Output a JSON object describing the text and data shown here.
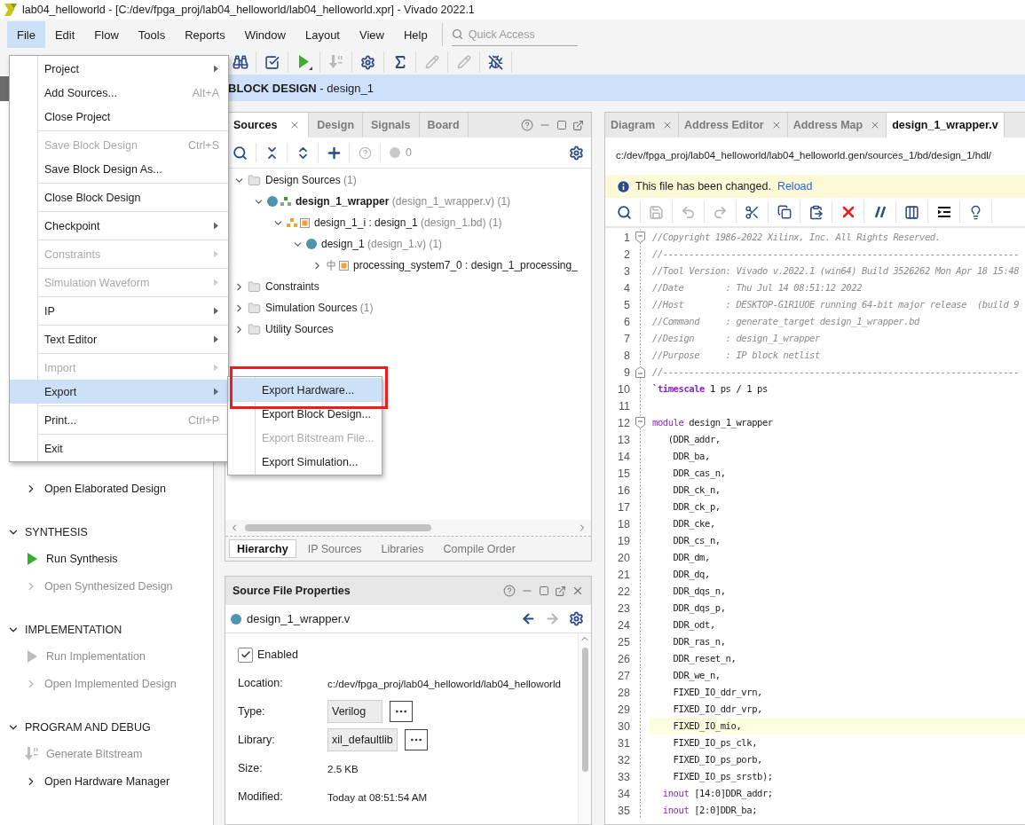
{
  "window": {
    "title": "lab04_helloworld - [C:/dev/fpga_proj/lab04_helloworld/lab04_helloworld.xpr] - Vivado 2022.1"
  },
  "menu_bar": [
    {
      "label": "File",
      "selected": true
    },
    {
      "label": "Edit",
      "selected": false
    },
    {
      "label": "Flow",
      "selected": false
    },
    {
      "label": "Tools",
      "selected": false
    },
    {
      "label": "Reports",
      "selected": false
    },
    {
      "label": "Window",
      "selected": false
    },
    {
      "label": "Layout",
      "selected": false
    },
    {
      "label": "View",
      "selected": false
    },
    {
      "label": "Help",
      "selected": false
    }
  ],
  "quick_access": {
    "placeholder": "Quick Access"
  },
  "toolbar": [
    {
      "kind": "binoculars",
      "disabled": false
    },
    {
      "kind": "check",
      "disabled": false
    },
    {
      "kind": "run",
      "disabled": false
    },
    {
      "kind": "bitstream",
      "disabled": true
    },
    {
      "kind": "gear",
      "disabled": false
    },
    {
      "kind": "sigma",
      "disabled": false
    },
    {
      "kind": "probe",
      "disabled": true
    },
    {
      "kind": "probe",
      "disabled": true
    },
    {
      "kind": "debug",
      "disabled": false
    }
  ],
  "flow_navigator": {
    "sections": [
      {
        "items": [
          {
            "label": "Open Elaborated Design",
            "kind": "expand",
            "disabled": false
          }
        ]
      },
      {
        "title": "SYNTHESIS",
        "expanded": true,
        "items": [
          {
            "label": "Run Synthesis",
            "kind": "run",
            "disabled": false
          },
          {
            "label": "Open Synthesized Design",
            "kind": "expand",
            "disabled": true
          }
        ]
      },
      {
        "title": "IMPLEMENTATION",
        "expanded": true,
        "items": [
          {
            "label": "Run Implementation",
            "kind": "run",
            "disabled": true
          },
          {
            "label": "Open Implemented Design",
            "kind": "expand",
            "disabled": true
          }
        ]
      },
      {
        "title": "PROGRAM AND DEBUG",
        "expanded": true,
        "items": [
          {
            "label": "Generate Bitstream",
            "kind": "bitstream",
            "disabled": true
          },
          {
            "label": "Open Hardware Manager",
            "kind": "expand",
            "disabled": false
          }
        ]
      }
    ]
  },
  "header": {
    "title": "**BLOCK DESIGN** - design_1"
  },
  "sources_panel": {
    "tabs": [
      {
        "label": "Sources",
        "selected": true
      },
      {
        "label": "Design",
        "selected": false
      },
      {
        "label": "Signals",
        "selected": false
      },
      {
        "label": "Board",
        "selected": false
      }
    ],
    "issue_count": "0",
    "tree": [
      {
        "name": "Design Sources",
        "detail": "(1)",
        "kind": "folder",
        "expanded": true,
        "children": [
          {
            "name": "design_1_wrapper",
            "detail": "(design_1_wrapper.v) (1)",
            "kind": "top-module",
            "expanded": true,
            "children": [
              {
                "name": "design_1_i : design_1",
                "detail": "(design_1.bd) (1)",
                "kind": "block-design",
                "expanded": true,
                "children": [
                  {
                    "name": "design_1",
                    "detail": "(design_1.v) (1)",
                    "kind": "module",
                    "expanded": true,
                    "children": [
                      {
                        "name": "processing_system7_0 : design_1_processing_",
                        "kind": "ip",
                        "expanded": false
                      }
                    ]
                  }
                ]
              }
            ]
          }
        ]
      },
      {
        "name": "Constraints",
        "kind": "folder",
        "expanded": false
      },
      {
        "name": "Simulation Sources",
        "detail": "(1)",
        "kind": "folder",
        "expanded": false
      },
      {
        "name": "Utility Sources",
        "kind": "folder",
        "expanded": false
      }
    ],
    "bottom_tabs": [
      {
        "label": "Hierarchy",
        "selected": true
      },
      {
        "label": "IP Sources",
        "selected": false
      },
      {
        "label": "Libraries",
        "selected": false
      },
      {
        "label": "Compile Order",
        "selected": false
      }
    ]
  },
  "properties_panel": {
    "title": "Source File Properties",
    "file": "design_1_wrapper.v",
    "enabled": {
      "label": "Enabled",
      "checked": true
    },
    "rows": [
      {
        "label": "Location:",
        "value": "c:/dev/fpga_proj/lab04_helloworld/lab04_helloworld",
        "kind": "text"
      },
      {
        "label": "Type:",
        "value": "Verilog",
        "kind": "select"
      },
      {
        "label": "Library:",
        "value": "xil_defaultlib",
        "kind": "select"
      },
      {
        "label": "Size:",
        "value": "2.5 KB",
        "kind": "text"
      },
      {
        "label": "Modified:",
        "value": "Today at 08:51:54 AM",
        "kind": "text"
      }
    ]
  },
  "editor": {
    "tabs": [
      {
        "label": "Diagram",
        "selected": false
      },
      {
        "label": "Address Editor",
        "selected": false
      },
      {
        "label": "Address Map",
        "selected": false
      },
      {
        "label": "design_1_wrapper.v",
        "selected": true
      }
    ],
    "path": "c:/dev/fpga_proj/lab04_helloworld/lab04_helloworld.gen/sources_1/bd/design_1/hdl/",
    "notice": {
      "text": "This file has been changed.",
      "link": "Reload"
    },
    "toolbar": [
      {
        "kind": "search",
        "disabled": false
      },
      {
        "kind": "save",
        "disabled": true
      },
      {
        "kind": "undo",
        "disabled": true
      },
      {
        "kind": "redo",
        "disabled": true
      },
      {
        "kind": "cut",
        "disabled": false
      },
      {
        "kind": "copy",
        "disabled": false
      },
      {
        "kind": "paste",
        "disabled": false
      },
      {
        "kind": "delete",
        "disabled": false
      },
      {
        "kind": "comment",
        "disabled": false
      },
      {
        "kind": "columns",
        "disabled": false
      },
      {
        "kind": "indent",
        "disabled": false
      },
      {
        "kind": "hint",
        "disabled": false
      }
    ],
    "lines": [
      {
        "number": "1",
        "kind": "fold-start",
        "current": false,
        "tokens": [
          {
            "text": "//Copyright 1986-2022 Xilinx, Inc. All Rights Reserved.",
            "kind": "comment"
          }
        ]
      },
      {
        "number": "2",
        "current": false,
        "tokens": [
          {
            "text": "//--------------------------------------------------------------------",
            "kind": "comment"
          }
        ]
      },
      {
        "number": "3",
        "current": false,
        "tokens": [
          {
            "text": "//Tool Version: Vivado v.2022.1 (win64) Build 3526262 Mon Apr 18 15:48",
            "kind": "comment"
          }
        ]
      },
      {
        "number": "4",
        "current": false,
        "tokens": [
          {
            "text": "//Date        : Thu Jul 14 08:51:12 2022",
            "kind": "comment"
          }
        ]
      },
      {
        "number": "5",
        "current": false,
        "tokens": [
          {
            "text": "//Host        : DESKTOP-G1R1UOE running 64-bit major release  (build 9",
            "kind": "comment"
          }
        ]
      },
      {
        "number": "6",
        "current": false,
        "tokens": [
          {
            "text": "//Command     : generate_target design_1_wrapper.bd",
            "kind": "comment"
          }
        ]
      },
      {
        "number": "7",
        "current": false,
        "tokens": [
          {
            "text": "//Design      : design_1_wrapper",
            "kind": "comment"
          }
        ]
      },
      {
        "number": "8",
        "current": false,
        "tokens": [
          {
            "text": "//Purpose     : IP block netlist",
            "kind": "comment"
          }
        ]
      },
      {
        "number": "9",
        "kind": "fold-end",
        "current": false,
        "tokens": [
          {
            "text": "//--------------------------------------------------------------------",
            "kind": "comment"
          }
        ]
      },
      {
        "number": "10",
        "current": false,
        "tokens": [
          {
            "text": "`timescale",
            "kind": "directive"
          },
          {
            "text": " 1 ps / 1 ps",
            "kind": "plain"
          }
        ]
      },
      {
        "number": "11",
        "current": false
      },
      {
        "number": "12",
        "kind": "fold-start",
        "current": false,
        "tokens": [
          {
            "text": "module",
            "kind": "keyword"
          },
          {
            "text": " design_1_wrapper",
            "kind": "plain"
          }
        ]
      },
      {
        "number": "13",
        "current": false,
        "tokens": [
          {
            "text": "   (DDR_addr,",
            "kind": "plain"
          }
        ]
      },
      {
        "number": "14",
        "current": false,
        "tokens": [
          {
            "text": "    DDR_ba,",
            "kind": "plain"
          }
        ]
      },
      {
        "number": "15",
        "current": false,
        "tokens": [
          {
            "text": "    DDR_cas_n,",
            "kind": "plain"
          }
        ]
      },
      {
        "number": "16",
        "current": false,
        "tokens": [
          {
            "text": "    DDR_ck_n,",
            "kind": "plain"
          }
        ]
      },
      {
        "number": "17",
        "current": false,
        "tokens": [
          {
            "text": "    DDR_ck_p,",
            "kind": "plain"
          }
        ]
      },
      {
        "number": "18",
        "current": false,
        "tokens": [
          {
            "text": "    DDR_cke,",
            "kind": "plain"
          }
        ]
      },
      {
        "number": "19",
        "current": false,
        "tokens": [
          {
            "text": "    DDR_cs_n,",
            "kind": "plain"
          }
        ]
      },
      {
        "number": "20",
        "current": false,
        "tokens": [
          {
            "text": "    DDR_dm,",
            "kind": "plain"
          }
        ]
      },
      {
        "number": "21",
        "current": false,
        "tokens": [
          {
            "text": "    DDR_dq,",
            "kind": "plain"
          }
        ]
      },
      {
        "number": "22",
        "current": false,
        "tokens": [
          {
            "text": "    DDR_dqs_n,",
            "kind": "plain"
          }
        ]
      },
      {
        "number": "23",
        "current": false,
        "tokens": [
          {
            "text": "    DDR_dqs_p,",
            "kind": "plain"
          }
        ]
      },
      {
        "number": "24",
        "current": false,
        "tokens": [
          {
            "text": "    DDR_odt,",
            "kind": "plain"
          }
        ]
      },
      {
        "number": "25",
        "current": false,
        "tokens": [
          {
            "text": "    DDR_ras_n,",
            "kind": "plain"
          }
        ]
      },
      {
        "number": "26",
        "current": false,
        "tokens": [
          {
            "text": "    DDR_reset_n,",
            "kind": "plain"
          }
        ]
      },
      {
        "number": "27",
        "current": false,
        "tokens": [
          {
            "text": "    DDR_we_n,",
            "kind": "plain"
          }
        ]
      },
      {
        "number": "28",
        "current": false,
        "tokens": [
          {
            "text": "    FIXED_IO_ddr_vrn,",
            "kind": "plain"
          }
        ]
      },
      {
        "number": "29",
        "current": false,
        "tokens": [
          {
            "text": "    FIXED_IO_ddr_vrp,",
            "kind": "plain"
          }
        ]
      },
      {
        "number": "30",
        "current": true,
        "tokens": [
          {
            "text": "    FIXED_IO_mio,",
            "kind": "plain"
          }
        ]
      },
      {
        "number": "31",
        "current": false,
        "tokens": [
          {
            "text": "    FIXED_IO_ps_clk,",
            "kind": "plain"
          }
        ]
      },
      {
        "number": "32",
        "current": false,
        "tokens": [
          {
            "text": "    FIXED_IO_ps_porb,",
            "kind": "plain"
          }
        ]
      },
      {
        "number": "33",
        "current": false,
        "tokens": [
          {
            "text": "    FIXED_IO_ps_srstb);",
            "kind": "plain"
          }
        ]
      },
      {
        "number": "34",
        "current": false,
        "tokens": [
          {
            "text": "  inout",
            "kind": "keyword"
          },
          {
            "text": " [14:0]DDR_addr;",
            "kind": "plain"
          }
        ]
      },
      {
        "number": "35",
        "current": false,
        "tokens": [
          {
            "text": "  inout",
            "kind": "keyword"
          },
          {
            "text": " [2:0]DDR_ba;",
            "kind": "plain"
          }
        ]
      }
    ]
  },
  "file_menu": {
    "items": [
      {
        "kind": "item",
        "label": "Project",
        "submenu": true,
        "disabled": false,
        "selected": false
      },
      {
        "kind": "item",
        "label": "Add Sources...",
        "shortcut": "Alt+A",
        "submenu": false,
        "disabled": false,
        "selected": false
      },
      {
        "kind": "item",
        "label": "Close Project",
        "submenu": false,
        "disabled": false,
        "selected": false
      },
      {
        "kind": "separator"
      },
      {
        "kind": "item",
        "label": "Save Block Design",
        "shortcut": "Ctrl+S",
        "submenu": false,
        "disabled": true,
        "selected": false
      },
      {
        "kind": "item",
        "label": "Save Block Design As...",
        "submenu": false,
        "disabled": false,
        "selected": false
      },
      {
        "kind": "separator"
      },
      {
        "kind": "item",
        "label": "Close Block Design",
        "submenu": false,
        "disabled": false,
        "selected": false
      },
      {
        "kind": "separator"
      },
      {
        "kind": "item",
        "label": "Checkpoint",
        "submenu": true,
        "disabled": false,
        "selected": false
      },
      {
        "kind": "separator"
      },
      {
        "kind": "item",
        "label": "Constraints",
        "submenu": true,
        "disabled": true,
        "selected": false
      },
      {
        "kind": "separator"
      },
      {
        "kind": "item",
        "label": "Simulation Waveform",
        "submenu": true,
        "disabled": true,
        "selected": false
      },
      {
        "kind": "separator"
      },
      {
        "kind": "item",
        "label": "IP",
        "submenu": true,
        "disabled": false,
        "selected": false
      },
      {
        "kind": "separator"
      },
      {
        "kind": "item",
        "label": "Text Editor",
        "submenu": true,
        "disabled": false,
        "selected": false
      },
      {
        "kind": "separator"
      },
      {
        "kind": "item",
        "label": "Import",
        "submenu": true,
        "disabled": true,
        "selected": false
      },
      {
        "kind": "item",
        "label": "Export",
        "submenu": true,
        "disabled": false,
        "selected": true
      },
      {
        "kind": "separator"
      },
      {
        "kind": "item",
        "label": "Print...",
        "shortcut": "Ctrl+P",
        "submenu": false,
        "disabled": false,
        "selected": false
      },
      {
        "kind": "separator"
      },
      {
        "kind": "item",
        "label": "Exit",
        "submenu": false,
        "disabled": false,
        "selected": false
      }
    ]
  },
  "export_submenu": {
    "highlighted": true,
    "items": [
      {
        "label": "Export Hardware...",
        "disabled": false,
        "selected": true
      },
      {
        "label": "Export Block Design...",
        "disabled": false,
        "selected": false
      },
      {
        "label": "Export Bitstream File...",
        "disabled": true,
        "selected": false
      },
      {
        "label": "Export Simulation...",
        "disabled": false,
        "selected": false
      }
    ]
  }
}
